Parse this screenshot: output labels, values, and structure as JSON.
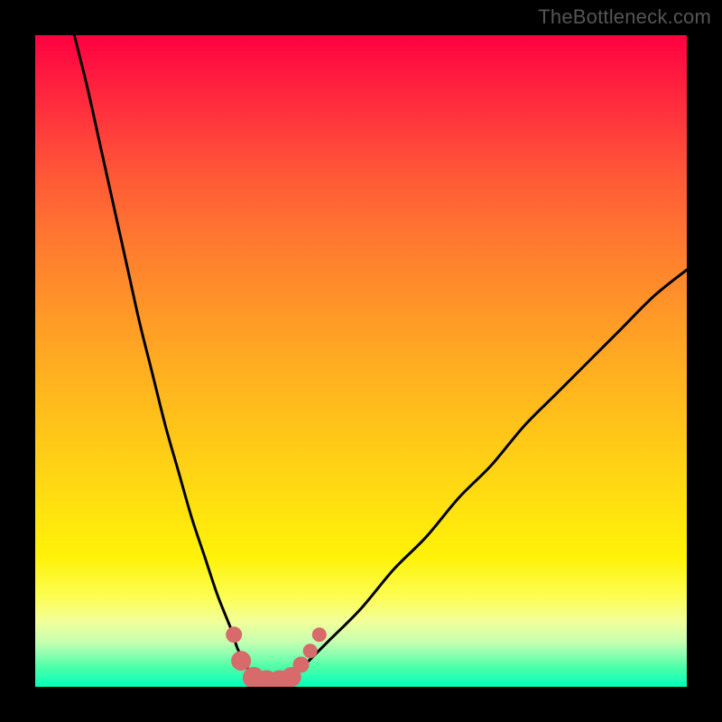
{
  "watermark": "TheBottleneck.com",
  "colors": {
    "background_frame": "#000000",
    "curve_stroke": "#000000",
    "marker_fill": "#d76a6a",
    "marker_stroke": "#c85858"
  },
  "chart_data": {
    "type": "line",
    "title": "",
    "xlabel": "",
    "ylabel": "",
    "xlim": [
      0,
      100
    ],
    "ylim": [
      0,
      100
    ],
    "grid": false,
    "legend": false,
    "background": "vertical rainbow gradient (red top → green bottom)",
    "series": [
      {
        "name": "left-branch",
        "x": [
          6,
          8,
          10,
          12,
          14,
          16,
          18,
          20,
          22,
          24,
          26,
          28,
          30,
          31,
          32,
          33
        ],
        "y": [
          100,
          92,
          83,
          74,
          65,
          56,
          48,
          40,
          33,
          26,
          20,
          14,
          9,
          6,
          4,
          2
        ]
      },
      {
        "name": "valley-floor",
        "x": [
          33,
          34,
          35,
          36,
          37,
          38,
          39,
          40
        ],
        "y": [
          2,
          1.2,
          0.9,
          0.9,
          0.9,
          1,
          1.3,
          2
        ]
      },
      {
        "name": "right-branch",
        "x": [
          40,
          42,
          45,
          50,
          55,
          60,
          65,
          70,
          75,
          80,
          85,
          90,
          95,
          100
        ],
        "y": [
          2,
          4,
          7,
          12,
          18,
          23,
          29,
          34,
          40,
          45,
          50,
          55,
          60,
          64
        ]
      }
    ],
    "markers": [
      {
        "x": 30.5,
        "y": 8,
        "r": 9
      },
      {
        "x": 31.6,
        "y": 4,
        "r": 11
      },
      {
        "x": 33.5,
        "y": 1.4,
        "r": 12
      },
      {
        "x": 35.5,
        "y": 0.9,
        "r": 12
      },
      {
        "x": 37.5,
        "y": 0.9,
        "r": 12
      },
      {
        "x": 39.3,
        "y": 1.5,
        "r": 11
      },
      {
        "x": 40.8,
        "y": 3.4,
        "r": 9
      },
      {
        "x": 42.2,
        "y": 5.5,
        "r": 8
      },
      {
        "x": 43.6,
        "y": 8.0,
        "r": 8
      }
    ]
  }
}
